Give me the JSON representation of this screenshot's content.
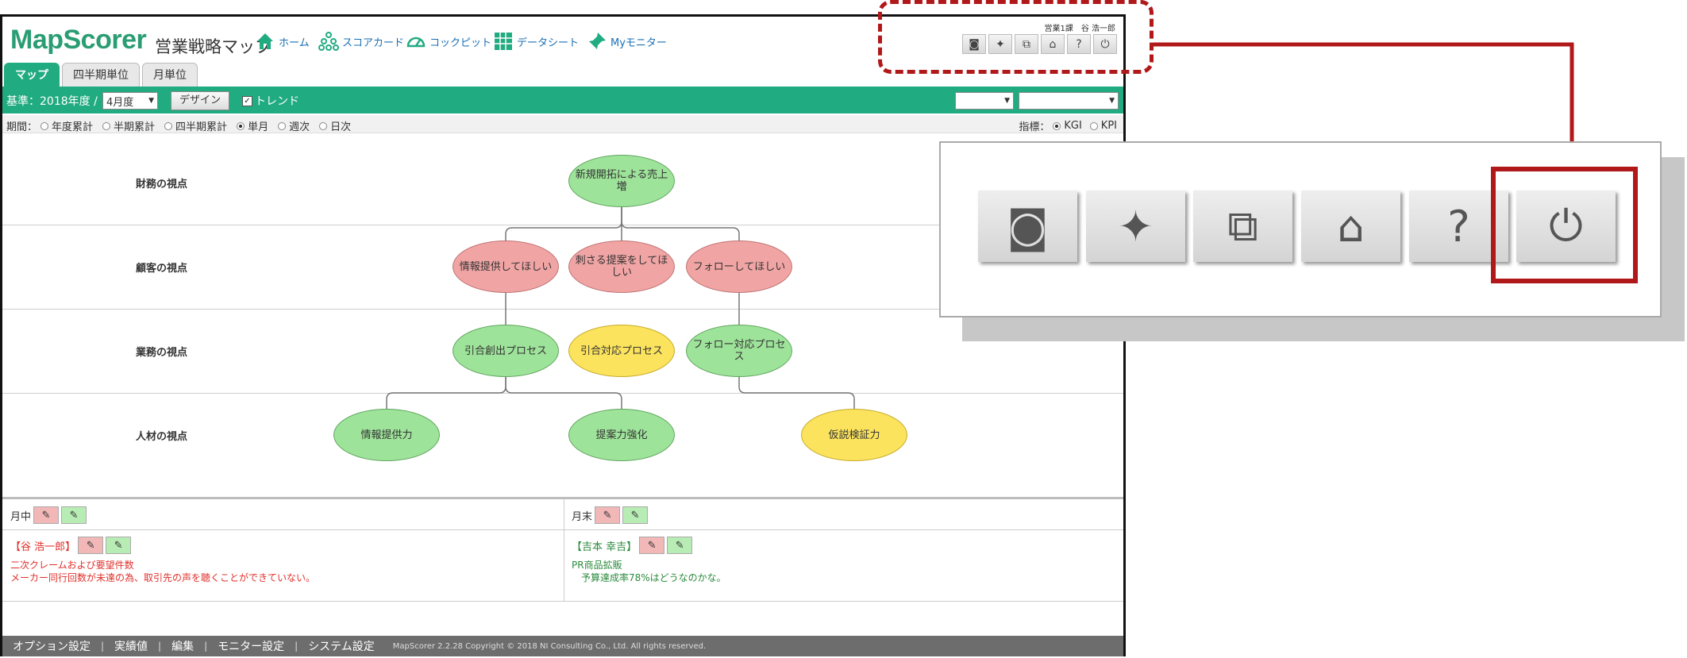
{
  "header": {
    "logo": "MapScorer",
    "title": "営業戦略マップ",
    "nav": [
      {
        "label": "ホーム",
        "icon": "home-icon"
      },
      {
        "label": "スコアカード",
        "icon": "scorecard-icon"
      },
      {
        "label": "コックピット",
        "icon": "cockpit-gauge-icon"
      },
      {
        "label": "データシート",
        "icon": "datasheet-icon"
      },
      {
        "label": "Myモニター",
        "icon": "pin-icon"
      }
    ],
    "user": "営業1課　谷 浩一郎",
    "tool_buttons": [
      {
        "icon": "camera-icon",
        "glyph": "◙"
      },
      {
        "icon": "sparkle-icon",
        "glyph": "✦"
      },
      {
        "icon": "structure-icon",
        "glyph": "⧉"
      },
      {
        "icon": "home-icon",
        "glyph": "⌂"
      },
      {
        "icon": "help-icon",
        "glyph": "?"
      },
      {
        "icon": "power-icon",
        "glyph": "⏻"
      }
    ]
  },
  "tabs": [
    {
      "label": "マップ",
      "active": true
    },
    {
      "label": "四半期単位",
      "active": false
    },
    {
      "label": "月単位",
      "active": false
    }
  ],
  "toolbar": {
    "base_label": "基準：2018年度 /",
    "month_value": "4月度",
    "design_label": "デザイン",
    "trend_label": "トレンド",
    "trend_checked": true,
    "select1_value": "",
    "select2_value": ""
  },
  "period": {
    "label": "期間：",
    "options": [
      {
        "label": "年度累計",
        "selected": false
      },
      {
        "label": "半期累計",
        "selected": false
      },
      {
        "label": "四半期累計",
        "selected": false
      },
      {
        "label": "単月",
        "selected": true
      },
      {
        "label": "週次",
        "selected": false
      },
      {
        "label": "日次",
        "selected": false
      }
    ],
    "indicator_label": "指標：",
    "indicator_options": [
      {
        "label": "KGI",
        "selected": true
      },
      {
        "label": "KPI",
        "selected": false
      }
    ]
  },
  "lanes": [
    "財務の視点",
    "顧客の視点",
    "業務の視点",
    "人材の視点"
  ],
  "nodes": [
    {
      "text": "新規開拓による売上増",
      "color": "green"
    },
    {
      "text": "情報提供してほしい",
      "color": "red"
    },
    {
      "text": "刺さる提案をしてほしい",
      "color": "red"
    },
    {
      "text": "フォローしてほしい",
      "color": "red"
    },
    {
      "text": "引合創出プロセス",
      "color": "green"
    },
    {
      "text": "引合対応プロセス",
      "color": "yellow"
    },
    {
      "text": "フォロー対応プロセス",
      "color": "green"
    },
    {
      "text": "情報提供力",
      "color": "green"
    },
    {
      "text": "提案力強化",
      "color": "green"
    },
    {
      "text": "仮説検証力",
      "color": "yellow"
    }
  ],
  "comments": {
    "left_label": "月中",
    "right_label": "月末",
    "left_entry": {
      "name": "【谷 浩一郎】",
      "lines": [
        "二次クレームおよび要望件数",
        "メーカー同行回数が未達の為、取引先の声を聴くことができていない。"
      ]
    },
    "right_entry": {
      "name": "【吉本 幸吉】",
      "lines": [
        "PR商品拡販",
        "予算達成率78%はどうなのかな。"
      ]
    }
  },
  "footer": {
    "links": [
      "オプション設定",
      "実績値",
      "編集",
      "モニター設定",
      "システム設定"
    ],
    "copyright": "MapScorer 2.2.28 Copyright © 2018 NI Consulting Co., Ltd. All rights reserved."
  },
  "colors": {
    "brand_green": "#21ab80",
    "callout_red": "#b0181a"
  }
}
